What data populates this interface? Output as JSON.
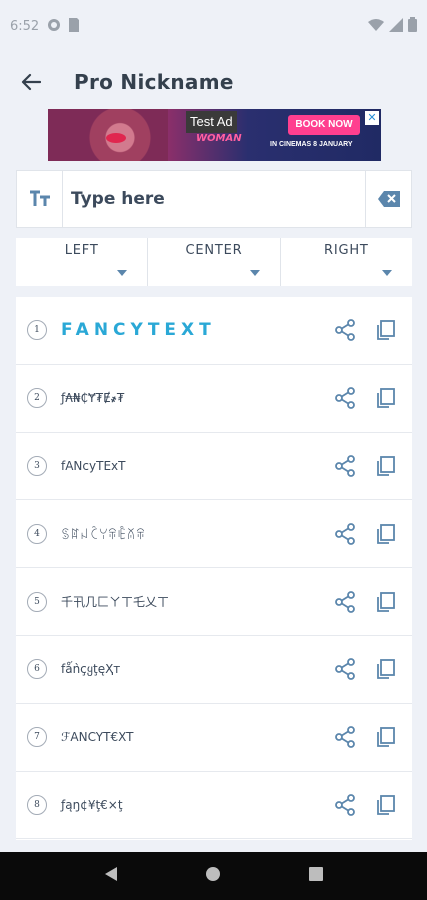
{
  "status_bar": {
    "time": "6:52"
  },
  "app_bar": {
    "title": "Pro Nickname"
  },
  "ad": {
    "label": "Test Ad",
    "headline": "WOMAN",
    "cta": "BOOK NOW",
    "subtext": "IN CINEMAS 8 JANUARY"
  },
  "input": {
    "placeholder": "Type here"
  },
  "align_options": [
    "LEFT",
    "CENTER",
    "RIGHT"
  ],
  "results": [
    {
      "num": "1",
      "text": "FANCYTEXT"
    },
    {
      "num": "2",
      "text": "ƒ₳₦₵Ɏ₮Ɇ҂₮"
    },
    {
      "num": "3",
      "text": "fANcyTExT"
    },
    {
      "num": "4",
      "text": "ꌗꍏꈤꉓꌩꋖꍟꊼꋖ"
    },
    {
      "num": "5",
      "text": "千卂几匚ㄚㄒ乇乂ㄒ"
    },
    {
      "num": "6",
      "text": "fǻǹçყţęҲт"
    },
    {
      "num": "7",
      "text": "ℱANCYT€XT"
    },
    {
      "num": "8",
      "text": "ƒąŋ¢¥ţ€×ţ"
    }
  ],
  "colors": {
    "accent": "#2aa8d6",
    "icon": "#5b86ac",
    "text": "#3c4a5c",
    "background": "#eef1f7"
  }
}
